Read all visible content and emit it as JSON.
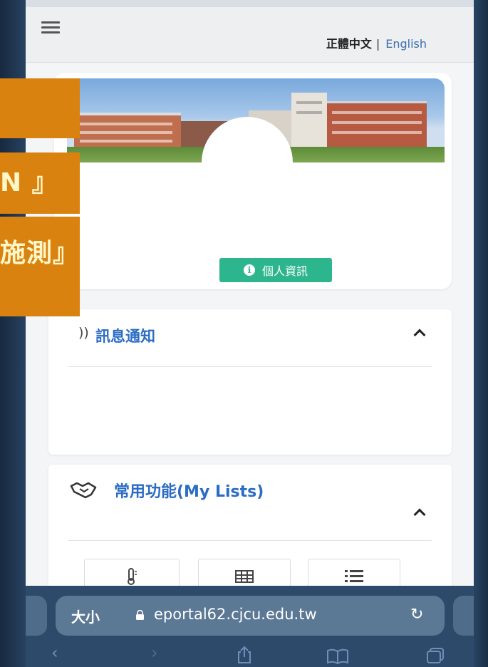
{
  "header": {
    "lang_zh": "正體中文",
    "lang_sep": "|",
    "lang_en": "English"
  },
  "profile": {
    "info_button": "個人資訊"
  },
  "notice": {
    "title": "訊息通知"
  },
  "lists": {
    "title": "常用功能(My Lists)"
  },
  "browser": {
    "text_size": "大小",
    "url": "eportal62.cjcu.edu.tw"
  },
  "overlay": {
    "callout_1": "",
    "callout_2": "N 』",
    "callout_3": "施測』"
  },
  "colors": {
    "accent_blue": "#2b6cc4",
    "info_green": "#2db58e",
    "callout_orange": "#d9820f",
    "callout_text": "#fff7c8"
  },
  "icons": {
    "menu": "hamburger-icon",
    "info": "info-circle-icon",
    "notice": "broadcast-icon",
    "lists": "handshake-icon",
    "tile_1": "thermometer-icon",
    "tile_2": "table-icon",
    "tile_3": "list-icon",
    "lock": "lock-icon",
    "reload": "reload-icon",
    "back": "back-chevron-icon",
    "forward": "forward-chevron-icon",
    "share": "share-icon",
    "bookmarks": "book-icon",
    "tabs": "tabs-icon"
  }
}
